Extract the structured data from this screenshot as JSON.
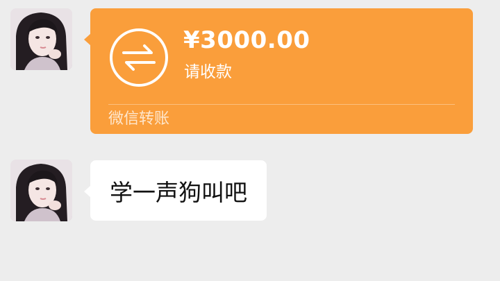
{
  "colors": {
    "background": "#ededed",
    "transfer_card": "#fa9e3b",
    "bubble": "#ffffff",
    "text_dark": "#111111",
    "text_light": "#ffffff"
  },
  "messages": [
    {
      "type": "transfer",
      "avatar_icon": "user-avatar",
      "icon": "transfer-arrows-icon",
      "amount": "¥3000.00",
      "status": "请收款",
      "footer": "微信转账"
    },
    {
      "type": "text",
      "avatar_icon": "user-avatar",
      "text": "学一声狗叫吧"
    }
  ]
}
